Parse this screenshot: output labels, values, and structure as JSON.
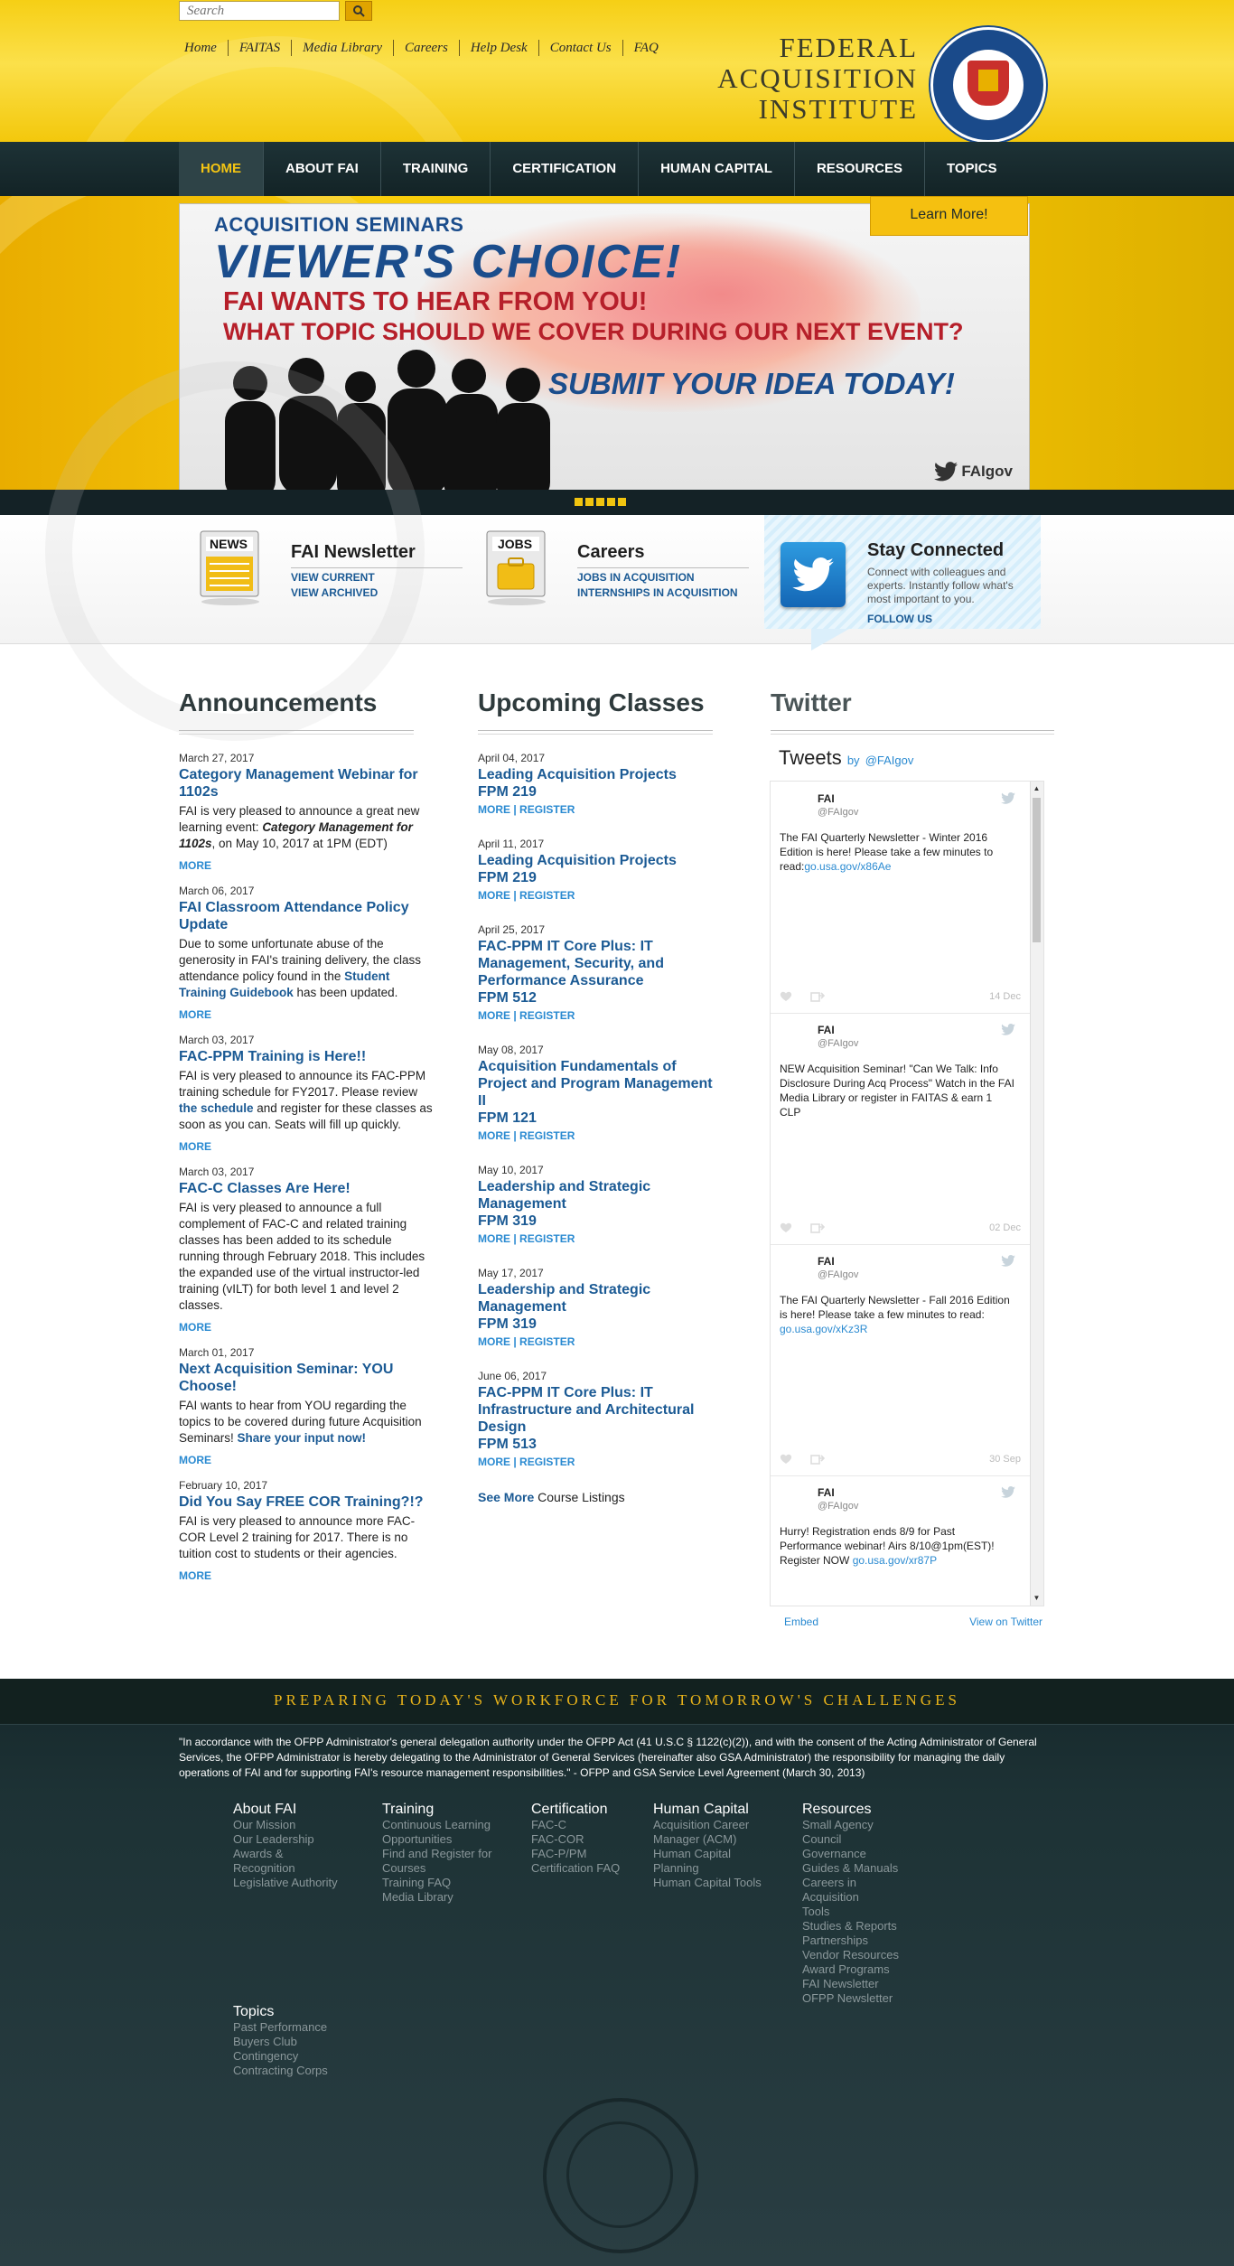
{
  "header": {
    "search_placeholder": "Search",
    "top_links": [
      "Home",
      "FAITAS",
      "Media Library",
      "Careers",
      "Help Desk",
      "Contact Us",
      "FAQ"
    ],
    "title_line1": "FEDERAL",
    "title_line2": "ACQUISITION",
    "title_line3": "INSTITUTE",
    "brand_color": "#f4c513"
  },
  "mainnav": {
    "items": [
      "HOME",
      "ABOUT FAI",
      "TRAINING",
      "CERTIFICATION",
      "HUMAN CAPITAL",
      "RESOURCES",
      "TOPICS"
    ]
  },
  "hero": {
    "kicker": "ACQUISITION SEMINARS",
    "headline": "VIEWER'S CHOICE!",
    "line1": "FAI WANTS TO HEAR FROM YOU!",
    "line2": "WHAT TOPIC SHOULD WE COVER DURING OUR NEXT EVENT?",
    "line3": "SUBMIT YOUR IDEA TODAY!",
    "handle": "FAIgov",
    "learn_more": "Learn More!",
    "slide_count": 5
  },
  "features": {
    "newsletter": {
      "icon_label": "NEWS",
      "title": "FAI Newsletter",
      "link1": "VIEW CURRENT",
      "link2": "VIEW ARCHIVED"
    },
    "careers": {
      "icon_label": "JOBS",
      "title": "Careers",
      "link1": "JOBS IN ACQUISITION",
      "link2": "INTERNSHIPS IN ACQUISITION"
    },
    "stay": {
      "title": "Stay Connected",
      "desc": "Connect with colleagues and experts. Instantly follow what's most important to you.",
      "link": "FOLLOW US"
    }
  },
  "announcements": {
    "heading": "Announcements",
    "items": [
      {
        "date": "March 27, 2017",
        "title": "Category Management Webinar for 1102s",
        "body_a": "FAI is very pleased to announce a great new learning event: ",
        "body_b": "Category Management for 1102s",
        "body_c": ", on May 10, 2017 at 1PM (EDT)",
        "more": "MORE"
      },
      {
        "date": "March 06, 2017",
        "title": "FAI Classroom Attendance Policy Update",
        "body_a": "Due to some unfortunate abuse of the generosity in FAI's training delivery, the class attendance policy found in the ",
        "link": "Student Training Guidebook",
        "body_c": " has been updated.",
        "more": "MORE"
      },
      {
        "date": "March 03, 2017",
        "title": "FAC-PPM Training is Here!!",
        "body_a": "FAI is very pleased to announce its FAC-PPM training schedule for FY2017. Please review ",
        "link": "the schedule",
        "body_c": " and register for these classes as soon as you can. Seats will fill up quickly.",
        "more": "MORE"
      },
      {
        "date": "March 03, 2017",
        "title": "FAC-C Classes Are Here!",
        "body_a": "FAI is very pleased to announce a full complement of FAC-C and related training classes has been added to its schedule running through February 2018. This includes the expanded use of the virtual instructor-led training (vILT) for both level 1 and level 2 classes.",
        "more": "MORE"
      },
      {
        "date": "March 01, 2017",
        "title": "Next Acquisition Seminar: YOU Choose!",
        "body_a": "FAI wants to hear from YOU regarding the topics to be covered during future Acquisition Seminars! ",
        "link": "Share your input now!",
        "more": "MORE"
      },
      {
        "date": "February 10, 2017",
        "title": "Did You Say FREE COR Training?!?",
        "body_a": "FAI is very pleased to announce more FAC-COR Level 2 training for 2017. There is no tuition cost to students or their agencies.",
        "more": "MORE"
      }
    ]
  },
  "classes": {
    "heading": "Upcoming Classes",
    "items": [
      {
        "date": "April 04, 2017",
        "title": "Leading Acquisition Projects",
        "code": "FPM 219",
        "more": "MORE",
        "register": "REGISTER"
      },
      {
        "date": "April 11, 2017",
        "title": "Leading Acquisition Projects",
        "code": "FPM 219",
        "more": "MORE",
        "register": "REGISTER"
      },
      {
        "date": "April 25, 2017",
        "title": "FAC-PPM IT Core Plus: IT Management, Security, and Performance Assurance",
        "code": "FPM 512",
        "more": "MORE",
        "register": "REGISTER"
      },
      {
        "date": "May 08, 2017",
        "title": "Acquisition Fundamentals of Project and Program Management II",
        "code": "FPM 121",
        "more": "MORE",
        "register": "REGISTER"
      },
      {
        "date": "May 10, 2017",
        "title": "Leadership and Strategic Management",
        "code": "FPM 319",
        "more": "MORE",
        "register": "REGISTER"
      },
      {
        "date": "May 17, 2017",
        "title": "Leadership and Strategic Management",
        "code": "FPM 319",
        "more": "MORE",
        "register": "REGISTER"
      },
      {
        "date": "June 06, 2017",
        "title": "FAC-PPM IT Core Plus: IT Infrastructure and Architectural Design",
        "code": "FPM 513",
        "more": "MORE",
        "register": "REGISTER"
      }
    ],
    "see_more": "See More",
    "see_more_tail": " Course Listings"
  },
  "twitter": {
    "heading": "Twitter",
    "widget_title": "Tweets",
    "by": "by",
    "by_handle": "@FAIgov",
    "tweets": [
      {
        "name": "FAI",
        "handle": "@FAIgov",
        "text": "The FAI Quarterly Newsletter - Winter 2016 Edition is here! Please take a few minutes to read:",
        "link": "go.usa.gov/x86Ae",
        "time": "14 Dec"
      },
      {
        "name": "FAI",
        "handle": "@FAIgov",
        "text": "NEW Acquisition Seminar! \"Can We Talk: Info Disclosure During Acq Process\" Watch in the FAI Media Library or register in FAITAS & earn 1 CLP",
        "link": "",
        "time": "02 Dec"
      },
      {
        "name": "FAI",
        "handle": "@FAIgov",
        "text": "The FAI Quarterly Newsletter - Fall 2016 Edition is here! Please take a few minutes to read:",
        "link": "go.usa.gov/xKz3R",
        "time": "30 Sep"
      },
      {
        "name": "FAI",
        "handle": "@FAIgov",
        "text": "Hurry! Registration ends 8/9 for Past Performance webinar! Airs 8/10@1pm(EST)! Register NOW",
        "link": "go.usa.gov/xr87P",
        "time": ""
      }
    ],
    "embed": "Embed",
    "view_on": "View on Twitter"
  },
  "footer": {
    "tagline": "PREPARING TODAY'S WORKFORCE FOR TOMORROW'S CHALLENGES",
    "quote": "\"In accordance with the OFPP Administrator's general delegation authority under the OFPP Act (41 U.S.C § 1122(c)(2)), and with the consent of the Acting Administrator of General Services, the OFPP Administrator is hereby delegating to the Administrator of General Services (hereinafter also GSA Administrator) the responsibility for managing the daily operations of FAI and for supporting FAI's resource management responsibilities.\" - OFPP and GSA Service Level Agreement (March 30, 2013)",
    "columns": [
      {
        "heading": "About FAI",
        "links": [
          "Our Mission",
          "Our Leadership",
          "Awards &",
          "Recognition",
          "Legislative Authority"
        ]
      },
      {
        "heading": "Training",
        "links": [
          "Continuous Learning",
          "Opportunities",
          "Find and Register for",
          "Courses",
          "Training FAQ",
          "Media Library"
        ]
      },
      {
        "heading": "Certification",
        "links": [
          "FAC-C",
          "FAC-COR",
          "FAC-P/PM",
          "Certification FAQ"
        ]
      },
      {
        "heading": "Human Capital",
        "links": [
          "Acquisition Career",
          "Manager (ACM)",
          "Human Capital",
          "Planning",
          "Human Capital Tools"
        ]
      },
      {
        "heading": "Resources",
        "links": [
          "Small Agency",
          "Council",
          "Governance",
          "Guides & Manuals",
          "Careers in",
          "Acquisition",
          "Tools",
          "Studies & Reports",
          "Partnerships",
          "Vendor Resources",
          "Award Programs",
          "FAI Newsletter",
          "OFPP Newsletter"
        ]
      },
      {
        "heading": "Topics",
        "links": [
          "Past Performance",
          "Buyers Club",
          "Contingency",
          "Contracting Corps"
        ]
      }
    ]
  }
}
